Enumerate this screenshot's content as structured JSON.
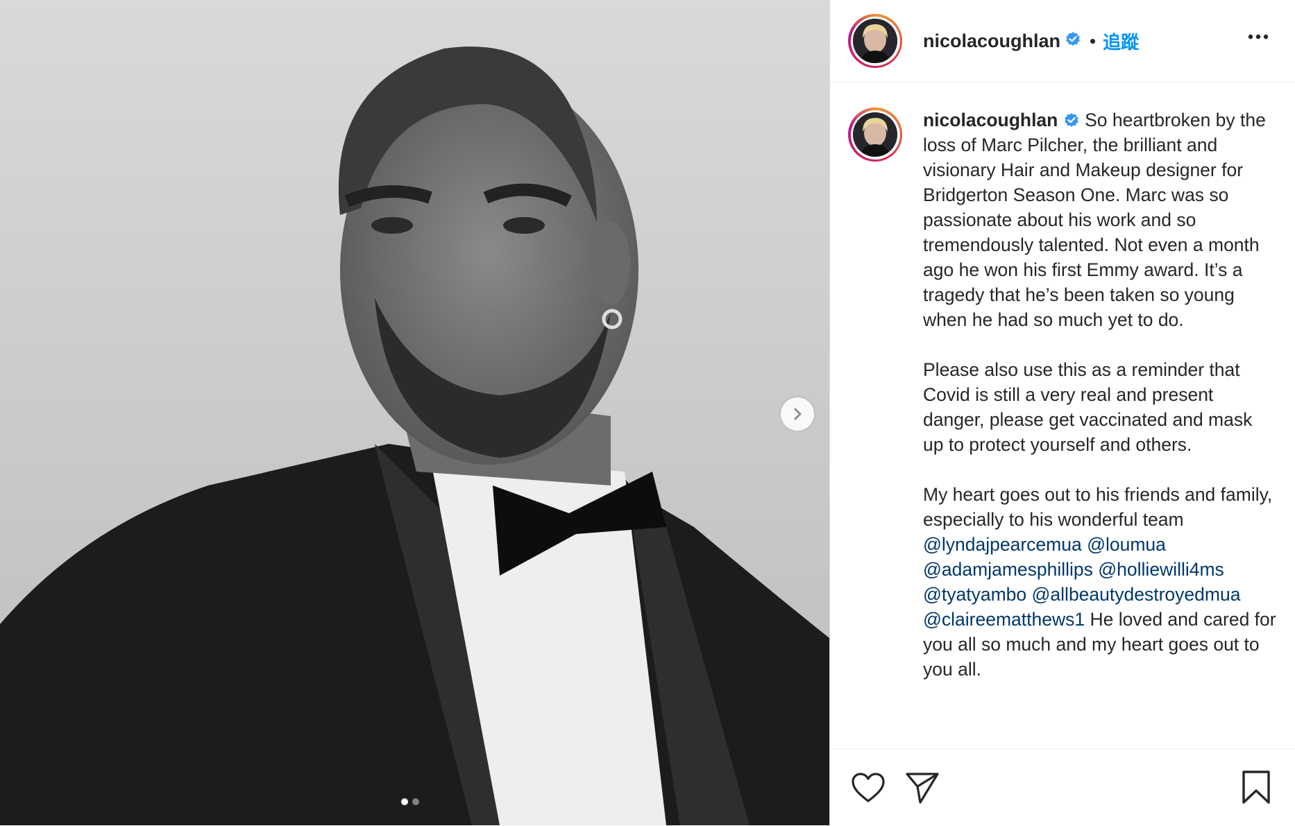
{
  "post": {
    "username": "nicolacoughlan",
    "follow_label": "追蹤",
    "separator": "•",
    "carousel": {
      "total_slides": 2,
      "active_slide": 1
    }
  },
  "caption": {
    "author": "nicolacoughlan",
    "para1": "So heartbroken by the loss of Marc Pilcher, the brilliant and visionary Hair and Makeup designer for Bridgerton Season One. Marc was so passionate about his work and so tremendously talented. Not even a month ago he won his first Emmy award. It’s a tragedy that he’s been taken so young when he had so much yet to do.",
    "para2": "Please also use this as a reminder that Covid is still a very real and present danger, please get vaccinated and mask up to protect yourself and others.",
    "para3": "My heart goes out to his friends and family, especially to his wonderful team",
    "mentions": [
      "@lyndajpearcemua",
      "@loumua",
      "@adamjamesphillips",
      "@holliewilli4ms",
      "@tyatyambo",
      "@allbeautydestroyedmua",
      "@claireematthews1"
    ],
    "tail": "He loved and cared for you all so much and my heart goes out to you all."
  },
  "colors": {
    "link_blue": "#0095f6",
    "mention_navy": "#00376b",
    "verified_blue": "#3897f0"
  },
  "icons": {
    "next": "chevron-right-icon",
    "more": "more-horizontal-icon",
    "like": "heart-icon",
    "share": "paper-plane-icon",
    "save": "bookmark-icon",
    "verified": "verified-badge-icon"
  }
}
